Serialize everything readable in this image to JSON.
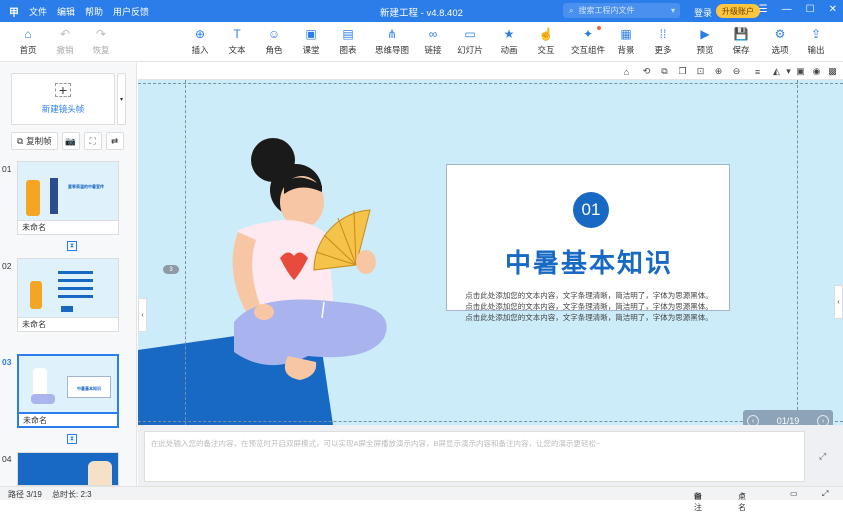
{
  "titlebar": {
    "logo": "甲",
    "menu": [
      "文件",
      "编辑",
      "帮助",
      "用户反馈"
    ],
    "title": "新建工程 - v4.8.402",
    "search_placeholder": "搜索工程内文件",
    "login": "登录",
    "upgrade": "升级账户",
    "accent": "#2b7de9"
  },
  "toolbar": {
    "home": "首页",
    "undo": "撤销",
    "redo": "恢复",
    "insert": "插入",
    "text": "文本",
    "role": "角色",
    "classroom": "课堂",
    "chart": "图表",
    "mindmap": "思维导图",
    "link": "链接",
    "slideshow": "幻灯片",
    "animation": "动画",
    "interaction": "交互",
    "interactive_component": "交互组件",
    "background": "背景",
    "more": "更多",
    "preview": "预览",
    "save": "保存",
    "options": "选项",
    "export": "输出"
  },
  "leftpanel": {
    "new_frame": "新建镜头帧",
    "copy_frame": "复制帧",
    "slides": [
      {
        "num": "01",
        "label": "未命名"
      },
      {
        "num": "02",
        "label": "未命名"
      },
      {
        "num": "03",
        "label": "未命名"
      },
      {
        "num": "04",
        "label": ""
      }
    ],
    "thumb1_title": "夏季高温的中暑宣传",
    "thumb3_title": "中暑基本知识"
  },
  "slide": {
    "number": "01",
    "title": "中暑基本知识",
    "lines": [
      "点击此处添加您的文本内容，文字条理清晰，简洁明了，字体为思源黑体。",
      "点击此处添加您的文本内容，文字条理清晰，简洁明了，字体为思源黑体。",
      "点击此处添加您的文本内容，文字条理清晰，简洁明了，字体为思源黑体。"
    ],
    "page_tag": "3",
    "pager": "01/19",
    "colors": {
      "bg": "#ccecf9",
      "title": "#1769c4",
      "floor": "#1769c4"
    }
  },
  "notes": {
    "placeholder": "在此处输入您的备注内容，在预览时开启双屏模式，可以实现A屏全屏播放演示内容，B屏显示演示内容和备注内容，让您的演示更轻松~"
  },
  "statusbar": {
    "path": "路径 3/19",
    "duration": "总时长: 2:3",
    "notes": "备注",
    "rollcall": "点名"
  }
}
